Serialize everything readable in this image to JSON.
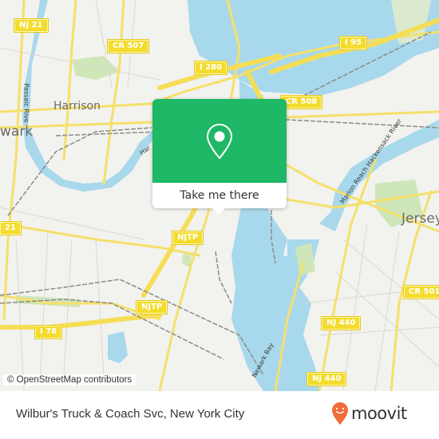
{
  "map": {
    "place_labels": {
      "harrison": "Harrison",
      "newark": "wark",
      "jersey": "Jersey"
    },
    "road_shields": {
      "nj21_top": "NJ 21",
      "cr507": "CR 507",
      "i280": "I 280",
      "i95": "I 95",
      "cr508": "CR 508",
      "njtp_center": "NJTP",
      "nj21_left": "21",
      "njtp_lower": "NJTP",
      "i78": "I 78",
      "cr501": "CR 501",
      "nj440_upper": "NJ 440",
      "nj440_lower": "NJ 440"
    },
    "water_labels": {
      "passaic": "Passaic Rive",
      "hackensack": "Marion Reach Hackensack River",
      "harrison_reach": "Har",
      "newark_bay": "Newark Bay"
    },
    "colors": {
      "land": "#f2f2ef",
      "water": "#a8d8ec",
      "park": "#cfe6b8",
      "road": "#f5e06a",
      "rail": "#8a8a8a"
    },
    "attribution": "© OpenStreetMap contributors"
  },
  "popup": {
    "icon": "location-pin-icon",
    "button_label": "Take me there",
    "color": "#1fb866"
  },
  "footer": {
    "place_title": "Wilbur's Truck & Coach Svc, New York City",
    "brand": "moovit",
    "brand_color": "#f26b3a"
  }
}
